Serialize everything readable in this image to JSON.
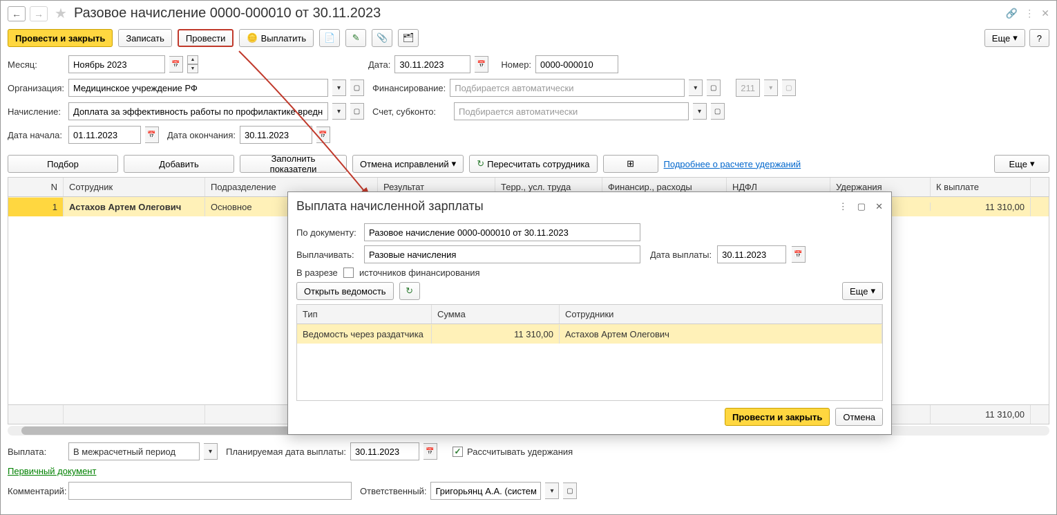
{
  "title": "Разовое начисление 0000-000010 от 30.11.2023",
  "toolbar": {
    "post_close": "Провести и закрыть",
    "write": "Записать",
    "post": "Провести",
    "pay": "Выплатить",
    "more": "Еще",
    "help": "?"
  },
  "form": {
    "month_lbl": "Месяц:",
    "month_val": "Ноябрь 2023",
    "date_lbl": "Дата:",
    "date_val": "30.11.2023",
    "number_lbl": "Номер:",
    "number_val": "0000-000010",
    "org_lbl": "Организация:",
    "org_val": "Медицинское учреждение РФ",
    "funding_lbl": "Финансирование:",
    "funding_ph": "Подбирается автоматически",
    "disabled_val": "211",
    "accrual_lbl": "Начисление:",
    "accrual_val": "Доплата за эффективность работы по профилактике вредны",
    "account_lbl": "Счет, субконто:",
    "account_ph": "Подбирается автоматически",
    "start_lbl": "Дата начала:",
    "start_val": "01.11.2023",
    "end_lbl": "Дата окончания:",
    "end_val": "30.11.2023"
  },
  "actions": {
    "pick": "Подбор",
    "add": "Добавить",
    "fill": "Заполнить показатели",
    "cancel_fix": "Отмена исправлений",
    "recalc": "Пересчитать сотрудника",
    "details_link": "Подробнее о расчете удержаний",
    "more": "Еще"
  },
  "table": {
    "headers": {
      "n": "N",
      "emp": "Сотрудник",
      "dept": "Подразделение",
      "res": "Результат",
      "terr": "Терр., усл. труда",
      "fin": "Финансир., расходы",
      "ndfl": "НДФЛ",
      "hold": "Удержания",
      "pay": "К выплате"
    },
    "rows": [
      {
        "n": "1",
        "emp": "Астахов Артем Олегович",
        "dept": "Основное",
        "pay": "11 310,00"
      }
    ],
    "foot_pay": "11 310,00"
  },
  "bottom": {
    "payment_lbl": "Выплата:",
    "payment_val": "В межрасчетный период",
    "plan_lbl": "Планируемая дата выплаты:",
    "plan_val": "30.11.2023",
    "calc_hold": "Рассчитывать удержания",
    "primary_doc": "Первичный документ",
    "comment_lbl": "Комментарий:",
    "resp_lbl": "Ответственный:",
    "resp_val": "Григорьянц А.А. (системн"
  },
  "modal": {
    "title": "Выплата начисленной зарплаты",
    "doc_lbl": "По документу:",
    "doc_val": "Разовое начисление 0000-000010 от 30.11.2023",
    "pay_lbl": "Выплачивать:",
    "pay_val": "Разовые начисления",
    "date_lbl": "Дата выплаты:",
    "date_val": "30.11.2023",
    "section_lbl": "В разрезе",
    "section_chk": "источников финансирования",
    "open_sheet": "Открыть ведомость",
    "more": "Еще",
    "headers": {
      "type": "Тип",
      "sum": "Сумма",
      "emp": "Сотрудники"
    },
    "rows": [
      {
        "type": "Ведомость через раздатчика",
        "sum": "11 310,00",
        "emp": "Астахов Артем Олегович"
      }
    ],
    "post_close": "Провести и закрыть",
    "cancel": "Отмена"
  }
}
